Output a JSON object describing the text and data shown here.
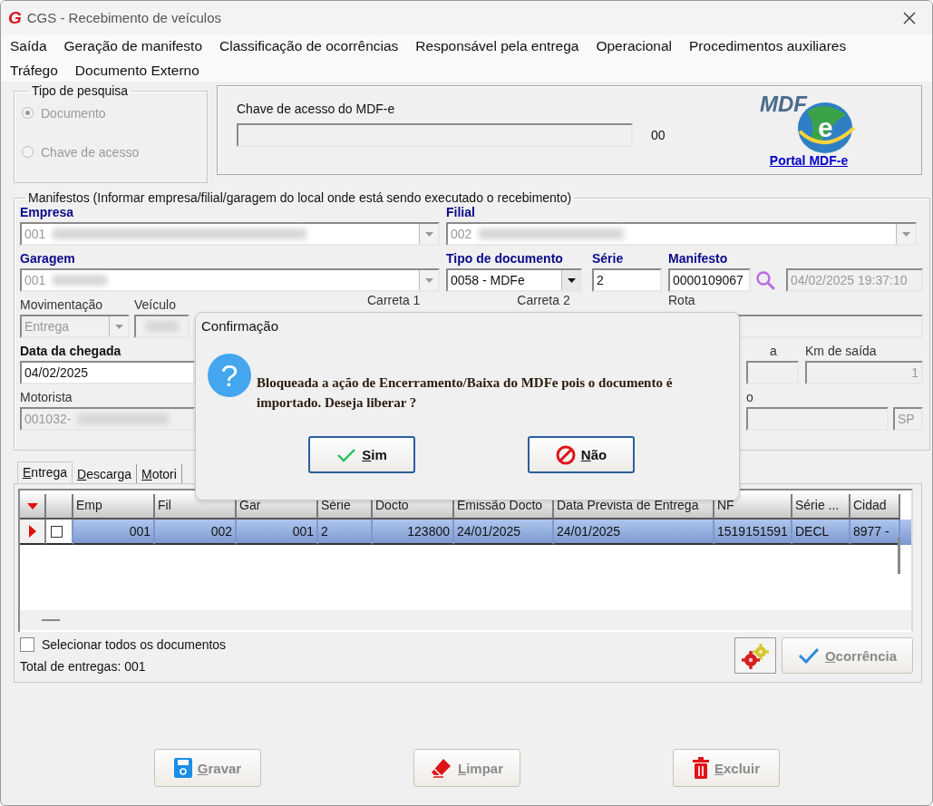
{
  "window": {
    "title": "CGS - Recebimento de veículos",
    "logo_letter": "G"
  },
  "menu": [
    {
      "label": "Saída"
    },
    {
      "label": "Geração de manifesto"
    },
    {
      "label": "Classificação de ocorrências"
    },
    {
      "label": "Responsável pela entrega"
    },
    {
      "label": "Operacional"
    },
    {
      "label": "Procedimentos auxiliares"
    },
    {
      "label": "Tráfego"
    },
    {
      "label": "Documento Externo"
    }
  ],
  "search_type": {
    "legend": "Tipo de pesquisa",
    "disabled": true,
    "options": [
      {
        "label": "Documento",
        "selected": true
      },
      {
        "label": "Chave de acesso",
        "selected": false
      }
    ]
  },
  "access_key": {
    "label": "Chave de acesso do MDF-e",
    "suffix": "00",
    "logo_text": "MDF",
    "logo_mark": "e",
    "link": "Portal MDF-e"
  },
  "manifests": {
    "legend": "Manifestos (Informar empresa/filial/garagem do local onde está sendo executado o recebimento)",
    "empresa": {
      "label": "Empresa",
      "required": true,
      "value": "001",
      "redacted": true,
      "disabled": true
    },
    "filial": {
      "label": "Filial",
      "required": true,
      "value": "002",
      "redacted": true,
      "disabled": true
    },
    "garagem": {
      "label": "Garagem",
      "required": true,
      "value": "001",
      "redacted": true,
      "disabled": true
    },
    "tipo_documento": {
      "label": "Tipo de documento",
      "required": true,
      "value": "0058 - MDFe",
      "disabled": false
    },
    "serie": {
      "label": "Série",
      "required": true,
      "value": "2",
      "disabled": false
    },
    "manifesto": {
      "label": "Manifesto",
      "required": true,
      "value": "0000109067",
      "disabled": false
    },
    "manifesto_date": {
      "value": "04/02/2025 19:37:10",
      "disabled": true
    },
    "movimentacao": {
      "label": "Movimentação",
      "value": "Entrega",
      "disabled": true
    },
    "veiculo": {
      "label": "Veículo",
      "redacted": true,
      "disabled": true
    },
    "carreta_1": {
      "label": "Carreta 1"
    },
    "carreta_2": {
      "label": "Carreta 2"
    },
    "rota": {
      "label": "Rota",
      "disabled": true
    },
    "data_chegada": {
      "label": "Data da chegada",
      "bold": true,
      "value": "04/02/2025",
      "disabled": false
    },
    "row4_field_2": {
      "label": "a",
      "disabled": true
    },
    "km_saida": {
      "label": "Km de saída",
      "value": "1",
      "disabled": true
    },
    "motorista": {
      "label": "Motorista",
      "value": "001032-",
      "redacted": true,
      "disabled": true
    },
    "row5_field_2": {
      "label": "o",
      "disabled": true
    },
    "uf": {
      "value": "SP",
      "disabled": true
    }
  },
  "tabs": [
    {
      "label": "Entrega",
      "selected": true
    },
    {
      "label": "Descarga",
      "selected": false
    },
    {
      "label": "Motori",
      "selected": false
    }
  ],
  "table": {
    "columns": [
      {
        "label": "Emp",
        "numeric": true
      },
      {
        "label": "Fil",
        "numeric": true
      },
      {
        "label": "Gar",
        "numeric": true
      },
      {
        "label": "Série",
        "numeric": false
      },
      {
        "label": "Docto",
        "numeric": true
      },
      {
        "label": "Emissão Docto",
        "numeric": false
      },
      {
        "label": "Data Prevista de Entrega",
        "numeric": false
      },
      {
        "label": "NF",
        "numeric": false
      },
      {
        "label": "Série ...",
        "numeric": false
      },
      {
        "label": "Cidad",
        "numeric": false
      }
    ],
    "rows": [
      {
        "selected": true,
        "checked": false,
        "cells": [
          "001",
          "002",
          "001",
          "2",
          "123800",
          "24/01/2025",
          "24/01/2025",
          "1519151591",
          "DECL",
          "8977 -"
        ]
      }
    ]
  },
  "select_all": {
    "label": "Selecionar todos os documentos",
    "checked": false
  },
  "total": "Total de entregas: 001",
  "occurrence_button": {
    "label": "Ocorrência",
    "disabled": true
  },
  "actions": [
    {
      "kind": "save",
      "label": "Gravar",
      "disabled": true
    },
    {
      "kind": "clear",
      "label": "Limpar",
      "disabled": true
    },
    {
      "kind": "delete",
      "label": "Excluir",
      "disabled": true
    }
  ],
  "dialog": {
    "title": "Confirmação",
    "icon": "?",
    "message": "Bloqueada a ação de Encerramento/Baixa do MDFe pois o documento é importado. Deseja liberar ?",
    "buttons": [
      {
        "kind": "yes",
        "label": "Sim"
      },
      {
        "kind": "no",
        "label": "Não"
      }
    ]
  }
}
